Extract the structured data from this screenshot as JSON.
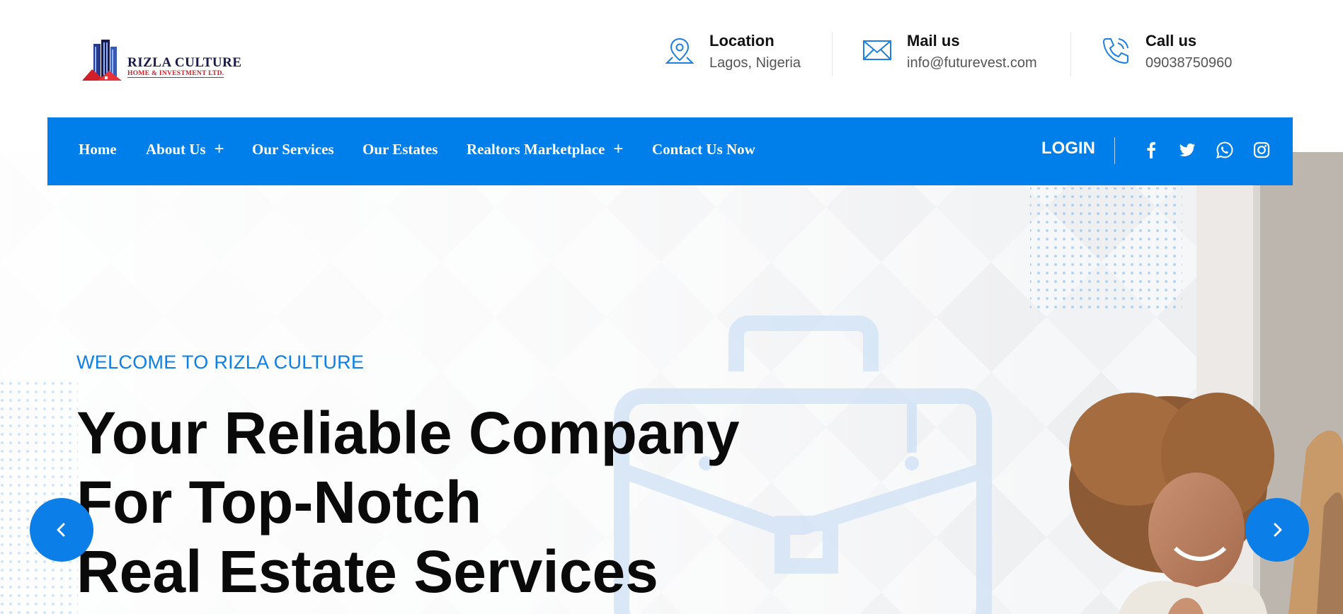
{
  "brand": {
    "name": "RIZLA CULTURE",
    "tagline": "HOME & INVESTMENT LTD."
  },
  "contacts": [
    {
      "icon": "location-pin-icon",
      "label": "Location",
      "value": "Lagos, Nigeria"
    },
    {
      "icon": "envelope-icon",
      "label": "Mail us",
      "value": "info@futurevest.com"
    },
    {
      "icon": "phone-icon",
      "label": "Call us",
      "value": "09038750960"
    }
  ],
  "nav": {
    "items": [
      {
        "label": "Home",
        "has_submenu": false
      },
      {
        "label": "About Us",
        "has_submenu": true
      },
      {
        "label": "Our Services",
        "has_submenu": false
      },
      {
        "label": "Our Estates",
        "has_submenu": false
      },
      {
        "label": "Realtors Marketplace",
        "has_submenu": true
      },
      {
        "label": "Contact Us Now",
        "has_submenu": false
      }
    ],
    "submenu_glyph": "+",
    "login_label": "LOGIN",
    "social": [
      "facebook-icon",
      "twitter-icon",
      "whatsapp-icon",
      "instagram-icon"
    ]
  },
  "hero": {
    "eyebrow": "WELCOME TO RIZLA CULTURE",
    "headline_lines": [
      "Your Reliable Company",
      "For Top-Notch",
      "Real Estate Services"
    ]
  },
  "colors": {
    "accent": "#007eea",
    "eyebrow": "#0d7fe6",
    "headline": "#0a0a0a",
    "logo_red": "#d11f2a",
    "logo_navy": "#1a1a4a"
  }
}
